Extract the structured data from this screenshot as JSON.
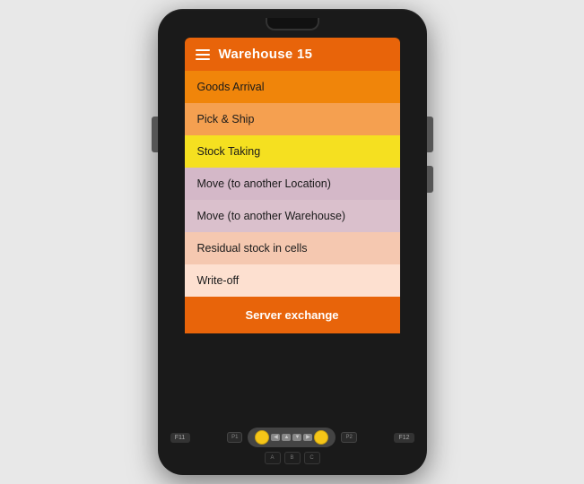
{
  "header": {
    "title": "Warehouse 15",
    "menu_icon": "hamburger"
  },
  "menu": {
    "items": [
      {
        "id": "goods-arrival",
        "label": "Goods Arrival",
        "color_class": "item-goods-arrival"
      },
      {
        "id": "pick-ship",
        "label": "Pick & Ship",
        "color_class": "item-pick-ship"
      },
      {
        "id": "stock-taking",
        "label": "Stock Taking",
        "color_class": "item-stock-taking"
      },
      {
        "id": "move-location",
        "label": "Move (to another Location)",
        "color_class": "item-move-location"
      },
      {
        "id": "move-warehouse",
        "label": "Move (to another Warehouse)",
        "color_class": "item-move-warehouse"
      },
      {
        "id": "residual",
        "label": "Residual stock in cells",
        "color_class": "item-residual"
      },
      {
        "id": "writeoff",
        "label": "Write-off",
        "color_class": "item-writeoff"
      },
      {
        "id": "server-exchange",
        "label": "Server exchange",
        "color_class": "item-server-exchange"
      }
    ]
  },
  "keypad": {
    "f11": "F11",
    "f12": "F12",
    "p1": "P1",
    "p2": "P2",
    "keys": [
      "A",
      "B",
      "C"
    ]
  }
}
